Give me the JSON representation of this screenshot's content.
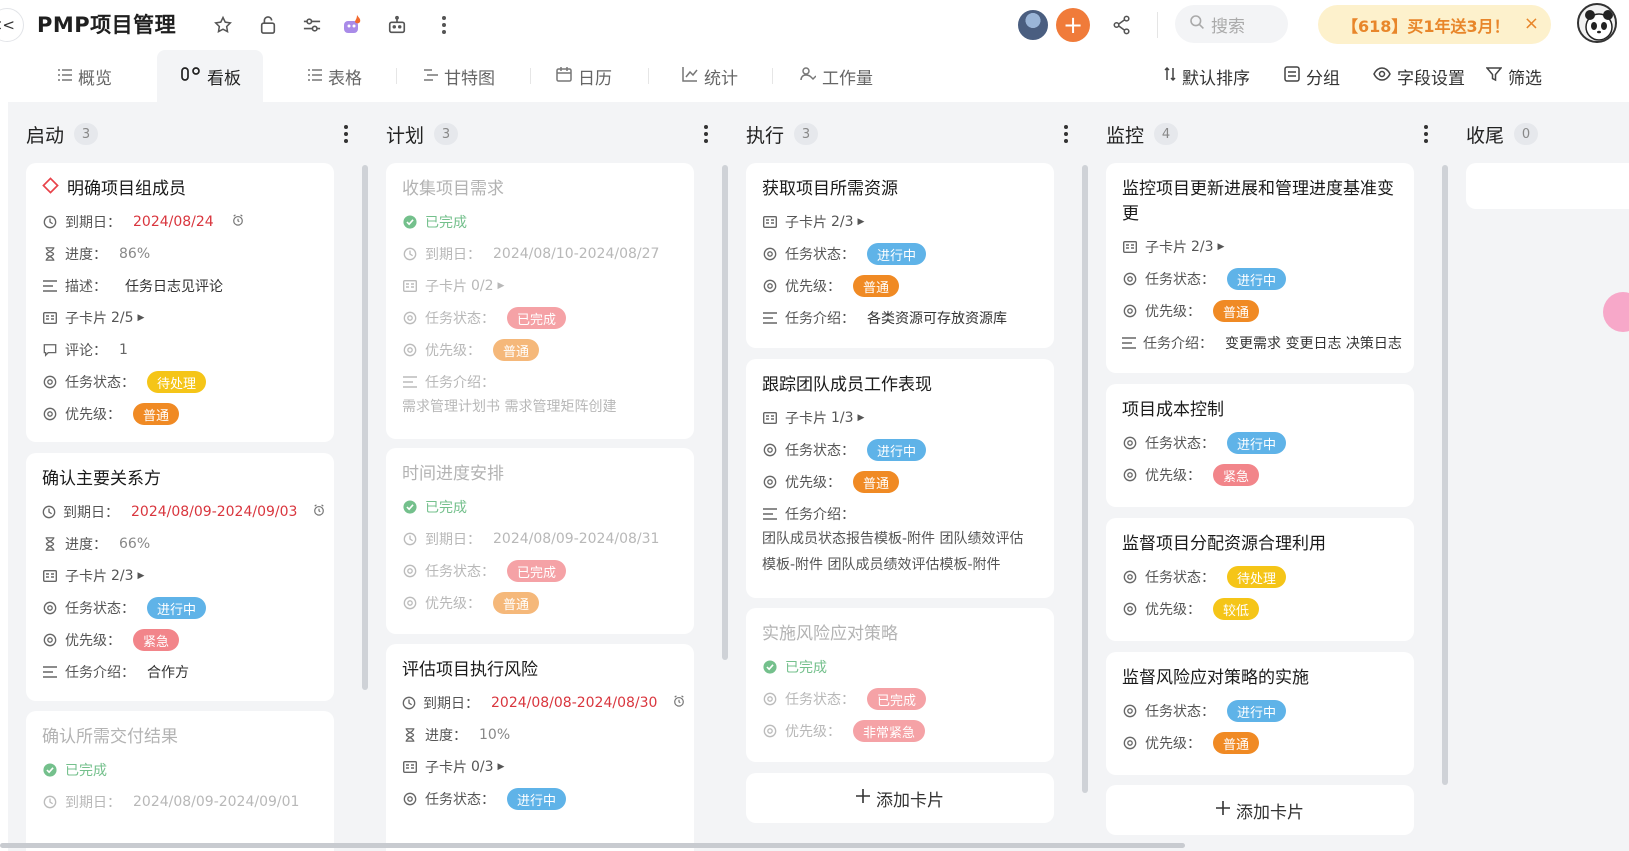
{
  "header": {
    "back_glyph": "<<",
    "title": "PMP项目管理",
    "icons": [
      "star-icon",
      "lock-icon",
      "sliders-icon",
      "mascot-icon",
      "robot-icon",
      "more-icon"
    ],
    "search_placeholder": "搜索",
    "promo_text": "【618】买1年送3月！",
    "promo_close": "×"
  },
  "tabs": [
    {
      "label": "概览",
      "icon": "list-icon"
    },
    {
      "label": "看板",
      "icon": "board-icon",
      "active": true
    },
    {
      "label": "表格",
      "icon": "table-icon"
    },
    {
      "label": "甘特图",
      "icon": "gantt-icon"
    },
    {
      "label": "日历",
      "icon": "calendar-icon"
    },
    {
      "label": "统计",
      "icon": "chart-icon"
    },
    {
      "label": "工作量",
      "icon": "workload-icon"
    }
  ],
  "toolbar": {
    "sort": "默认排序",
    "group": "分组",
    "fields": "字段设置",
    "filter": "筛选"
  },
  "labels": {
    "due": "到期日：",
    "progress": "进度：",
    "desc": "描述：",
    "subcards": "子卡片",
    "comment": "评论：",
    "status": "任务状态：",
    "priority": "优先级：",
    "intro": "任务介绍：",
    "done": "已完成",
    "add_card": "添加卡片"
  },
  "colors": {
    "pending": "#f5c518",
    "in_progress": "#5fb3e8",
    "completed": "#f2858a",
    "normal": "#f08a24",
    "urgent": "#f2858a",
    "low": "#f5c518",
    "very_urgent": "#f2858a",
    "accent": "#f07b3a"
  },
  "columns": [
    {
      "title": "启动",
      "count": "3",
      "cards": [
        {
          "title": "明确项目组成员",
          "due": "2024/08/24",
          "progress": "86%",
          "desc": "任务日志见评论",
          "subcards": "2/5",
          "comments": "1",
          "status": "待处理",
          "priority": "普通"
        },
        {
          "title": "确认主要关系方",
          "due": "2024/08/09-2024/09/03",
          "progress": "66%",
          "subcards": "2/3",
          "status": "进行中",
          "priority": "紧急",
          "intro": "合作方"
        },
        {
          "title": "确认所需交付结果",
          "done": "已完成",
          "due": "2024/08/09-2024/09/01"
        }
      ]
    },
    {
      "title": "计划",
      "count": "3",
      "cards": [
        {
          "title": "收集项目需求",
          "done": "已完成",
          "due": "2024/08/10-2024/08/27",
          "subcards": "0/2",
          "status": "已完成",
          "priority": "普通",
          "intro": "需求管理计划书 需求管理矩阵创建"
        },
        {
          "title": "时间进度安排",
          "done": "已完成",
          "due": "2024/08/09-2024/08/31",
          "status": "已完成",
          "priority": "普通"
        },
        {
          "title": "评估项目执行风险",
          "due": "2024/08/08-2024/08/30",
          "progress": "10%",
          "subcards": "0/3",
          "status": "进行中"
        }
      ]
    },
    {
      "title": "执行",
      "count": "3",
      "cards": [
        {
          "title": "获取项目所需资源",
          "subcards": "2/3",
          "status": "进行中",
          "priority": "普通",
          "intro": "各类资源可存放资源库"
        },
        {
          "title": "跟踪团队成员工作表现",
          "subcards": "1/3",
          "status": "进行中",
          "priority": "普通",
          "intro_line1": "团队成员状态报告模板-附件 团队绩效评估",
          "intro_line2": "模板-附件 团队成员绩效评估模板-附件"
        },
        {
          "title": "实施风险应对策略",
          "done": "已完成",
          "status": "已完成",
          "priority": "非常紧急"
        }
      ]
    },
    {
      "title": "监控",
      "count": "4",
      "cards": [
        {
          "title_line1": "监控项目更新进展和管理进度基准变",
          "title_line2": "更",
          "subcards": "2/3",
          "status": "进行中",
          "priority": "普通",
          "intro": "变更需求 变更日志 决策日志"
        },
        {
          "title": "项目成本控制",
          "status": "进行中",
          "priority": "紧急"
        },
        {
          "title": "监督项目分配资源合理利用",
          "status": "待处理",
          "priority": "较低"
        },
        {
          "title": "监督风险应对策略的实施",
          "status": "进行中",
          "priority": "普通"
        }
      ]
    },
    {
      "title": "收尾",
      "count": "0",
      "cards": []
    }
  ]
}
